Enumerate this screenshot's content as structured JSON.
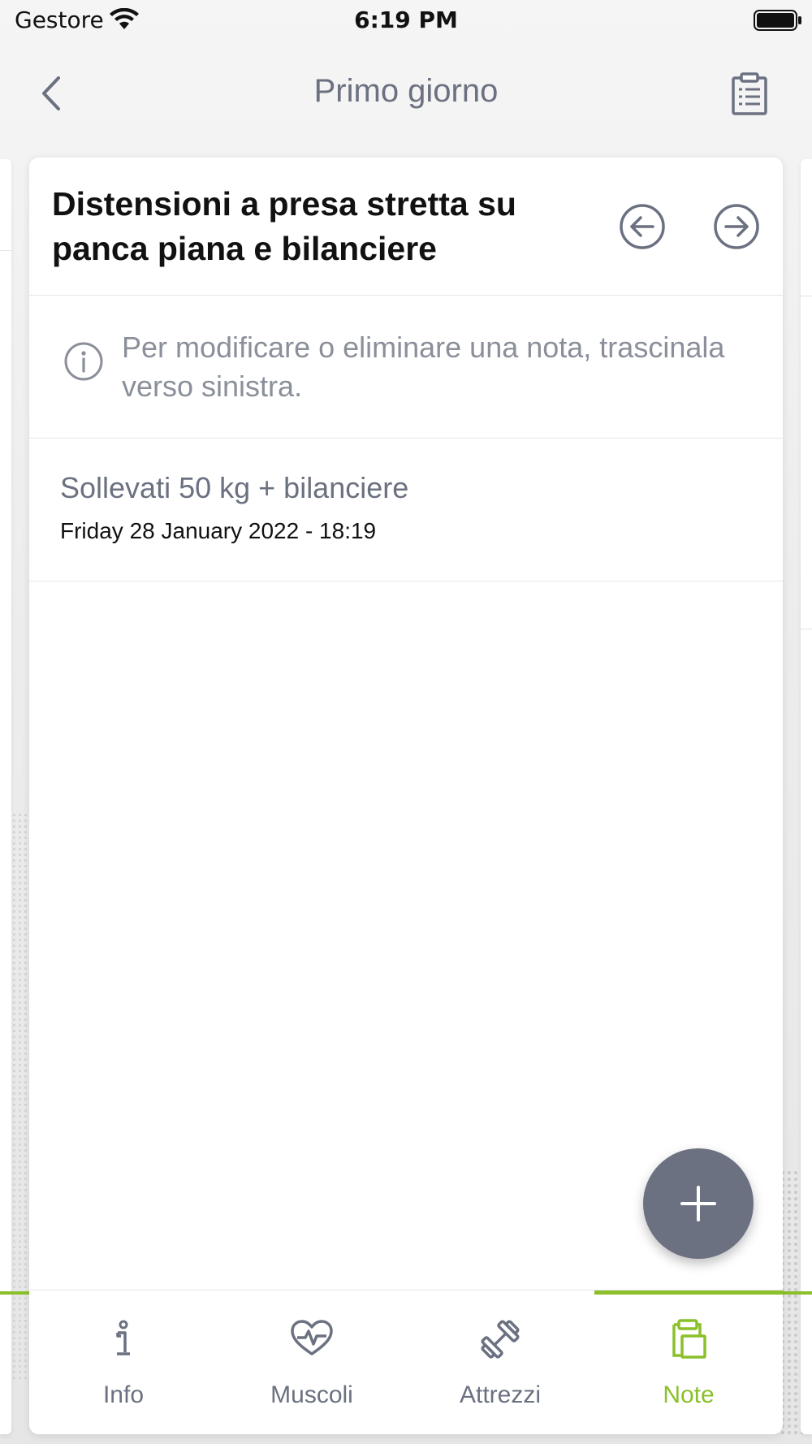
{
  "status_bar": {
    "carrier": "Gestore",
    "time": "6:19 PM"
  },
  "nav": {
    "title": "Primo giorno",
    "back_icon": "chevron-left-icon",
    "action_icon": "clipboard-list-icon"
  },
  "exercise": {
    "title": "Distensioni a presa stretta su panca piana e bilanciere"
  },
  "info": {
    "text": "Per modificare o eliminare una nota, trascinala verso sinistra."
  },
  "notes": [
    {
      "text": "Sollevati 50 kg + bilanciere",
      "date": "Friday 28 January 2022 - 18:19"
    }
  ],
  "tabs": [
    {
      "label": "Info",
      "icon": "info-icon",
      "active": false
    },
    {
      "label": "Muscoli",
      "icon": "heart-pulse-icon",
      "active": false
    },
    {
      "label": "Attrezzi",
      "icon": "dumbbell-icon",
      "active": false
    },
    {
      "label": "Note",
      "icon": "clipboard-copy-icon",
      "active": true
    }
  ],
  "colors": {
    "accent": "#8bc02a",
    "text_muted": "#6b7180",
    "fab": "#6b7180"
  }
}
